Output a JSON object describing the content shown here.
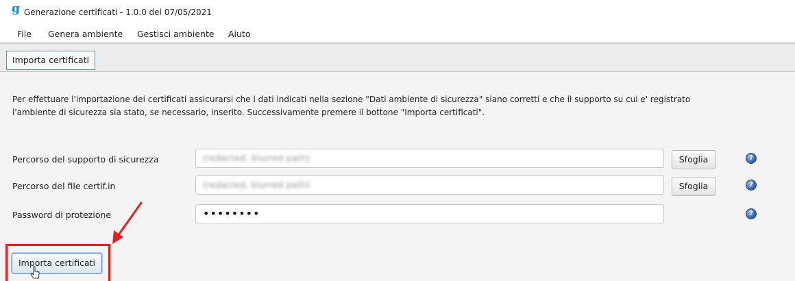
{
  "window": {
    "title": "Generazione certificati - 1.0.0 del 07/05/2021",
    "logo_glyph": "g"
  },
  "menu": {
    "items": [
      "File",
      "Genera ambiente",
      "Gestisci ambiente",
      "Aiuto"
    ]
  },
  "tabs": [
    {
      "label": "Importa certificati",
      "selected": true
    }
  ],
  "main": {
    "description": "Per effettuare l'importazione dei certificati assicurarsi che i dati indicati nella sezione \"Dati ambiente di sicurezza\" siano corretti e che il supporto su cui e' registrato l'ambiente di sicurezza sia stato, se necessario, inserito. Successivamente premere il bottone \"Importa certificati\".",
    "fields": [
      {
        "label": "Percorso del supporto di sicurezza",
        "value": "(redacted, blurred path)",
        "browse_label": "Sfoglia"
      },
      {
        "label": "Percorso del file certif.in",
        "value": "(redacted, blurred path)",
        "browse_label": "Sfoglia"
      },
      {
        "label": "Password di protezione",
        "value": "••••••••"
      }
    ],
    "import_button_label": "Importa certificati"
  },
  "icons": {
    "help": "help-icon",
    "cursor": "mouse-cursor-icon",
    "annotation_arrow": "arrow-annotation"
  },
  "colors": {
    "accent": "#1a86c9",
    "highlight": "#e81e1e",
    "help_icon": "#2f5f9c"
  }
}
